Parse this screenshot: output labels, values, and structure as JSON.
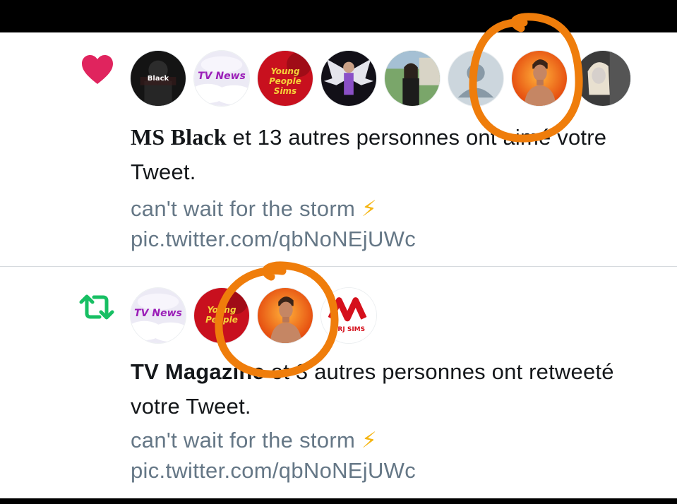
{
  "notifications": [
    {
      "type": "like",
      "icon": "heart-icon",
      "icon_color": "#e0245e",
      "avatars": [
        {
          "name": "ms-black",
          "label": "Black"
        },
        {
          "name": "tv-magazine",
          "label": "TV News"
        },
        {
          "name": "young-people-sims",
          "label": "Young People Sims"
        },
        {
          "name": "angel-avatar",
          "label": ""
        },
        {
          "name": "sims-girl-avatar",
          "label": ""
        },
        {
          "name": "default-profile",
          "label": ""
        },
        {
          "name": "orange-man-avatar",
          "label": ""
        },
        {
          "name": "blonde-avatar",
          "label": ""
        }
      ],
      "actor": "MS Black",
      "summary_rest": " et 13 autres personnes ont aimé votre Tweet.",
      "tweet_text": "can't wait for the storm",
      "tweet_emoji": "⚡",
      "tweet_link": "pic.twitter.com/qbNoNEjUWc"
    },
    {
      "type": "retweet",
      "icon": "retweet-icon",
      "icon_color": "#17bf63",
      "avatars": [
        {
          "name": "tv-magazine",
          "label": "TV News"
        },
        {
          "name": "young-people-sims",
          "label": "Young People"
        },
        {
          "name": "orange-man-avatar",
          "label": ""
        },
        {
          "name": "nrj-sims",
          "label": "NRJ SIMS"
        }
      ],
      "actor": "TV Magazine",
      "summary_rest": " et 3 autres personnes ont retweeté votre Tweet.",
      "tweet_text": "can't wait for the storm",
      "tweet_emoji": "⚡",
      "tweet_link": "pic.twitter.com/qbNoNEjUWc"
    }
  ],
  "annotation": {
    "color": "#ef7d0b"
  }
}
